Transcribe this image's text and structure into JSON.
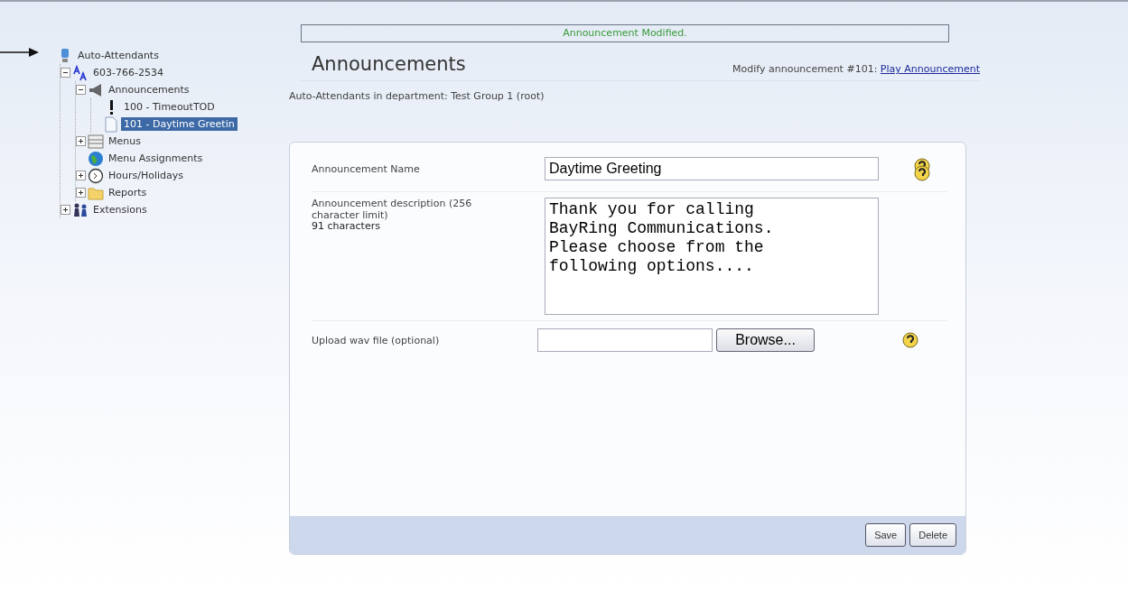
{
  "tree": [
    {
      "label": "Auto-Attendants",
      "kind": "root",
      "selected": false,
      "children": [
        {
          "label": "603-766-2534",
          "kind": "attendant",
          "selected": false,
          "expanded": true,
          "children": [
            {
              "label": "Announcements",
              "kind": "megaphone",
              "selected": false,
              "expanded": true,
              "children": [
                {
                  "label": "100 - TimeoutTOD",
                  "kind": "warning",
                  "selected": false
                },
                {
                  "label": "101 - Daytime Greetin",
                  "kind": "document",
                  "selected": true
                }
              ]
            },
            {
              "label": "Menus",
              "kind": "menu",
              "selected": false,
              "expanded": false
            },
            {
              "label": "Menu Assignments",
              "kind": "globe",
              "selected": false
            },
            {
              "label": "Hours/Holidays",
              "kind": "clock",
              "selected": false,
              "expanded": false
            },
            {
              "label": "Reports",
              "kind": "folder",
              "selected": false,
              "expanded": false
            }
          ]
        },
        {
          "label": "Extensions",
          "kind": "people",
          "selected": false,
          "expanded": false
        }
      ]
    }
  ],
  "message": "Announcement Modified.",
  "title": "Announcements",
  "subtitle_prefix": "Modify announcement #101: ",
  "subtitle_link": "Play Announcement",
  "department": "Auto-Attendants in department: Test Group 1 (root)",
  "form": {
    "name_label": "Announcement Name",
    "name_value": "Daytime Greeting",
    "description_label": "Announcement description (256 character limit)",
    "description_count": "91 characters",
    "description_value": "Thank you for calling BayRing Communications. Please choose from the following options....",
    "upload_label": "Upload wav file (optional)",
    "browse": "Browse..."
  },
  "buttons": [
    "Save",
    "Delete"
  ]
}
